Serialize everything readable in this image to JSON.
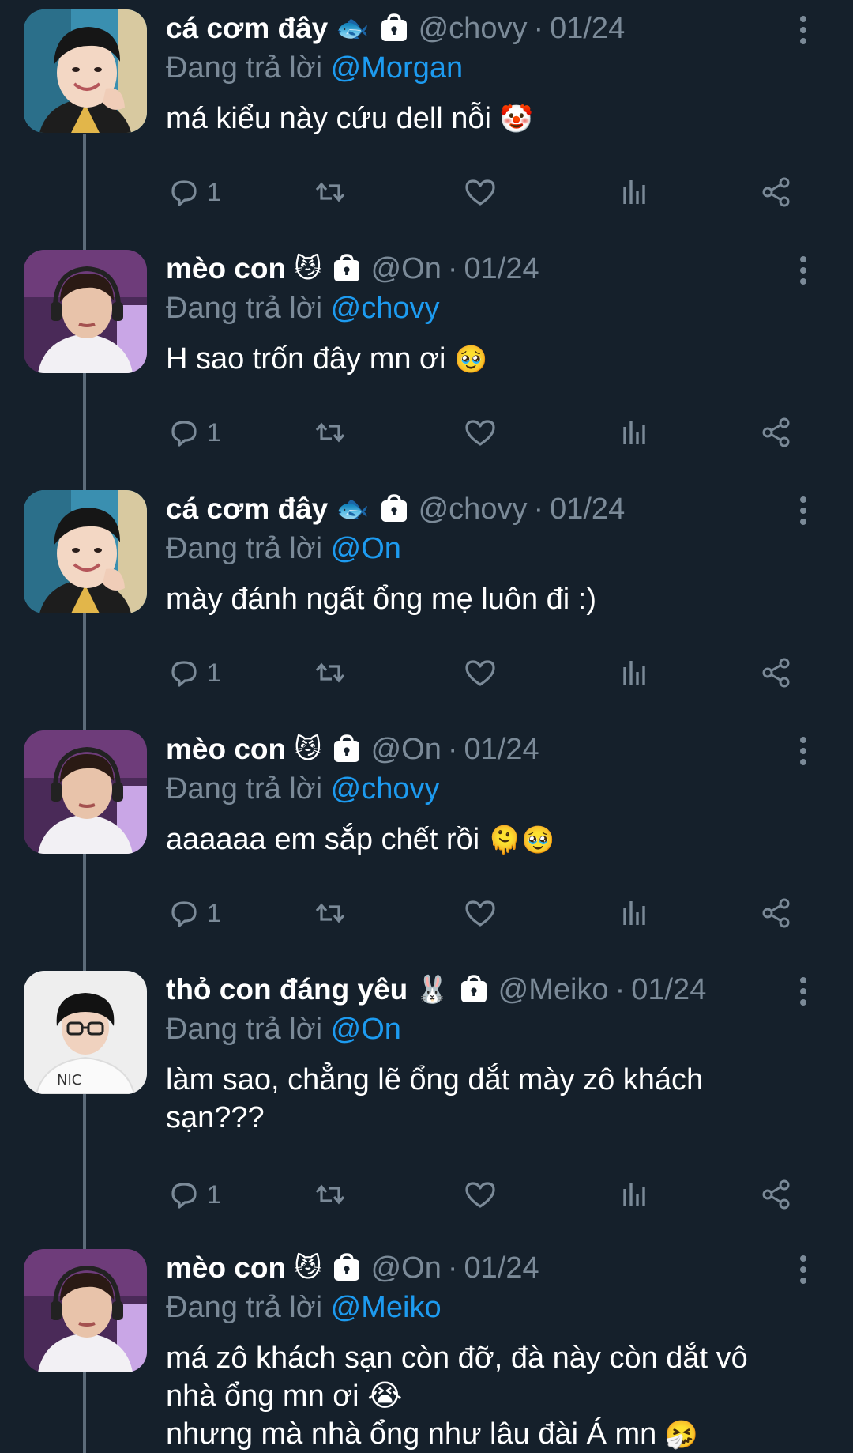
{
  "tweets": [
    {
      "name": "cá cơm đây",
      "emoji": "🐟",
      "handle": "@chovy",
      "date": "01/24",
      "reply_prefix": "Đang trả lời",
      "reply_to": "@Morgan",
      "text": "má kiểu này cứu dell nỗi",
      "text_emoji": "🤡",
      "reply_count": "1",
      "avatar": "boy-smiling-blue"
    },
    {
      "name": "mèo con",
      "emoji": "😼",
      "handle": "@On",
      "date": "01/24",
      "reply_prefix": "Đang trả lời",
      "reply_to": "@chovy",
      "text": "H sao trốn đây mn ơi",
      "text_emoji": "🥹",
      "reply_count": "1",
      "avatar": "boy-headset-purple"
    },
    {
      "name": "cá cơm đây",
      "emoji": "🐟",
      "handle": "@chovy",
      "date": "01/24",
      "reply_prefix": "Đang trả lời",
      "reply_to": "@On",
      "text": "mày đánh ngất ổng mẹ luôn đi :)",
      "text_emoji": "",
      "reply_count": "1",
      "avatar": "boy-smiling-blue"
    },
    {
      "name": "mèo con",
      "emoji": "😼",
      "handle": "@On",
      "date": "01/24",
      "reply_prefix": "Đang trả lời",
      "reply_to": "@chovy",
      "text": "aaaaaa em sắp chết rồi",
      "text_emoji": "🫠🥹",
      "reply_count": "1",
      "avatar": "boy-headset-purple"
    },
    {
      "name": "thỏ con đáng yêu",
      "emoji": "🐰",
      "handle": "@Meiko",
      "date": "01/24",
      "reply_prefix": "Đang trả lời",
      "reply_to": "@On",
      "text": "làm sao, chẳng lẽ ổng dắt mày zô khách\nsạn???",
      "text_emoji": "",
      "reply_count": "1",
      "avatar": "boy-glasses-white"
    },
    {
      "name": "mèo con",
      "emoji": "😼",
      "handle": "@On",
      "date": "01/24",
      "reply_prefix": "Đang trả lời",
      "reply_to": "@Meiko",
      "text": "má zô khách sạn còn đỡ, đà này còn dắt vô\nnhà ổng mn ơi 😭\nnhưng mà nhà ổng như lâu đài Á mn",
      "text_emoji": "🤧",
      "reply_count": "",
      "avatar": "boy-headset-purple"
    }
  ],
  "separator": "·",
  "colors": {
    "background": "#15202b",
    "muted": "#7b8a98",
    "mention": "#1d9bf0",
    "thread_line": "#5c6b79"
  },
  "icons": [
    "reply-icon",
    "retweet-icon",
    "like-icon",
    "views-icon",
    "share-icon",
    "more-icon",
    "lock-icon"
  ]
}
